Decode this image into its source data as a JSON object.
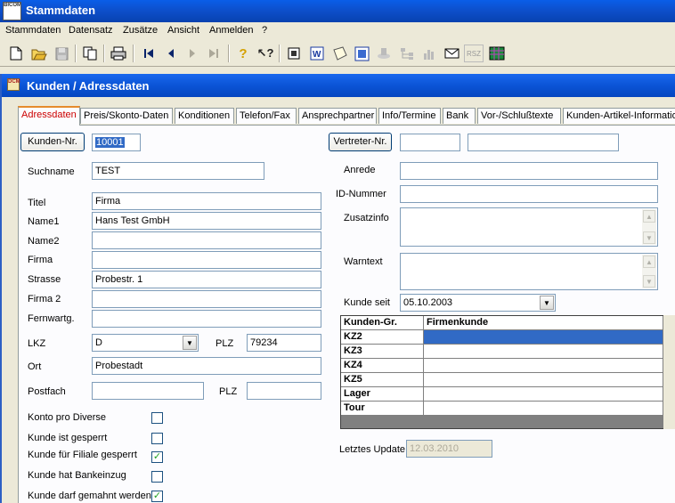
{
  "window": {
    "title": "Stammdaten",
    "icon_text": "BICOM"
  },
  "menu": [
    "Stammdaten",
    "Datensatz",
    "Zusätze",
    "Ansicht",
    "Anmelden",
    "?"
  ],
  "toolbar": {
    "icons": [
      "new-icon",
      "open-icon",
      "save-icon",
      "copy-icon",
      "print-icon",
      "first-record-icon",
      "previous-record-icon",
      "next-record-icon",
      "last-record-icon",
      "help-icon",
      "context-help-icon",
      "contacts-icon",
      "word-icon",
      "note-icon",
      "image-icon",
      "stamp-icon",
      "tree-icon",
      "chart-icon",
      "mail-icon",
      "rsz-icon",
      "grid-icon"
    ],
    "rsz_label": "RSZ"
  },
  "subwindow": {
    "title": "Kunden / Adressdaten",
    "icon_text": "DCM"
  },
  "tabs": [
    "Adressdaten",
    "Preis/Skonto-Daten",
    "Konditionen",
    "Telefon/Fax",
    "Ansprechpartner",
    "Info/Termine",
    "Bank",
    "Vor-/Schlußtexte",
    "Kunden-Artikel-Informationen"
  ],
  "form": {
    "kunden_nr_button": "Kunden-Nr.",
    "kunden_nr": "10001",
    "suchname_label": "Suchname",
    "suchname": "TEST",
    "titel_label": "Titel",
    "titel": "Firma",
    "name1_label": "Name1",
    "name1": "Hans Test GmbH",
    "name2_label": "Name2",
    "name2": "",
    "firma_label": "Firma",
    "firma": "",
    "strasse_label": "Strasse",
    "strasse": "Probestr. 1",
    "firma2_label": "Firma 2",
    "firma2": "",
    "fernwartg_label": "Fernwartg.",
    "fernwartg": "",
    "lkz_label": "LKZ",
    "lkz": "D",
    "plz_label": "PLZ",
    "plz": "79234",
    "ort_label": "Ort",
    "ort": "Probestadt",
    "postfach_label": "Postfach",
    "postfach": "",
    "plz2_label": "PLZ",
    "plz2": "",
    "checkboxes": [
      {
        "label": "Konto pro Diverse",
        "checked": false
      },
      {
        "label": "Kunde ist gesperrt",
        "checked": false
      },
      {
        "label": "Kunde für Filiale gesperrt",
        "checked": true
      },
      {
        "label": "Kunde hat Bankeinzug",
        "checked": false
      },
      {
        "label": "Kunde darf gemahnt werden",
        "checked": true
      }
    ],
    "vertreter_button": "Vertreter-Nr.",
    "vertreter_nr": "",
    "vertreter_name": "",
    "anrede_label": "Anrede",
    "anrede": "",
    "id_nummer_label": "ID-Nummer",
    "id_nummer": "",
    "zusatzinfo_label": "Zusatzinfo",
    "zusatzinfo": "",
    "warntext_label": "Warntext",
    "warntext": "",
    "kunde_seit_label": "Kunde seit",
    "kunde_seit": "05.10.2003",
    "letztes_update_label": "Letztes Update",
    "letztes_update": "12.03.2010"
  },
  "grid": {
    "headers": [
      "Kunden-Gr.",
      "Firmenkunde"
    ],
    "rows": [
      {
        "key": "KZ2",
        "value": ""
      },
      {
        "key": "KZ3",
        "value": ""
      },
      {
        "key": "KZ4",
        "value": ""
      },
      {
        "key": "KZ5",
        "value": ""
      },
      {
        "key": "Lager",
        "value": ""
      },
      {
        "key": "Tour",
        "value": ""
      }
    ]
  },
  "colors": {
    "titlebar": "#0b54d6",
    "selection": "#316ac5",
    "active_tab_text": "#cc0000",
    "face": "#ece9d8"
  }
}
